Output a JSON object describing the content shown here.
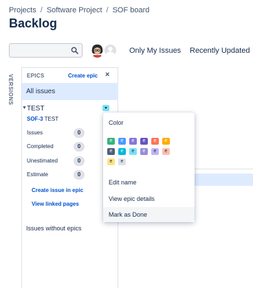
{
  "breadcrumb": [
    "Projects",
    "Software Project",
    "SOF board"
  ],
  "page_title": "Backlog",
  "search": {
    "value": "",
    "placeholder": ""
  },
  "quick_filters": [
    "Only My Issues",
    "Recently Updated"
  ],
  "versions_label": "VERSIONS",
  "epic_panel": {
    "title": "EPICS",
    "create_label": "Create epic",
    "close_glyph": "×",
    "all_issues": "All issues",
    "epic": {
      "name": "TEST",
      "key": "SOF-3",
      "summary": "TEST",
      "stats": [
        {
          "label": "Issues",
          "value": "0"
        },
        {
          "label": "Completed",
          "value": "0"
        },
        {
          "label": "Unestimated",
          "value": "0"
        },
        {
          "label": "Estimate",
          "value": "0"
        }
      ],
      "create_issue_label": "Create issue in epic",
      "view_linked_label": "View linked pages"
    },
    "issues_without_epics": "Issues without epics"
  },
  "menu": {
    "color_label": "Color",
    "swatch_letter": "e",
    "swatch_colors": [
      [
        "#36b37e",
        "#4c9aff",
        "#8777d9",
        "#6554c0",
        "#ff7452",
        "#ffab00"
      ],
      [
        "#505f79",
        "#00b8d9",
        "#79e2f2",
        "#998dd9",
        "#c0b6f2",
        "#ffbdad"
      ],
      [
        "#ffe380",
        "#dfe1e6"
      ]
    ],
    "items": [
      "Edit name",
      "View epic details",
      "Mark as Done"
    ],
    "active_item": "Mark as Done"
  }
}
